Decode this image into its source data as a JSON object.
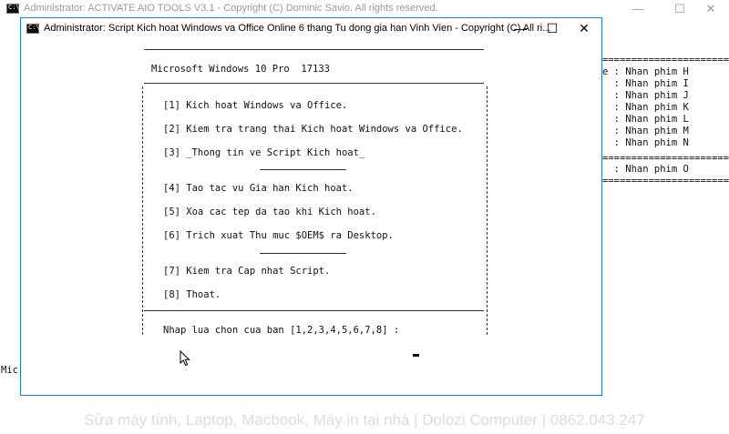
{
  "back_window": {
    "title": "Administrator:  ACTIVATE AIO TOOLS V3.1 - Copyright (C) Dominic Savio. All rights reserved.",
    "right_panel_lines": [
      "========================",
      "e : Nhan phim H",
      "  : Nhan phim I",
      "  : Nhan phim J",
      "  : Nhan phim K",
      "  : Nhan phim L",
      "  : Nhan phim M",
      "  : Nhan phim N",
      "========================",
      "  : Nhan phim O",
      "========================"
    ],
    "left_dot": ".",
    "left_partial_text": "Mic"
  },
  "front_window": {
    "title": "Administrator:  Script Kich hoat Windows va Office Online 6 thang Tu dong gia han Vinh Vien - Copyright (C) All ri...",
    "os_info": "Microsoft Windows 10 Pro  17133",
    "menu": [
      {
        "label": "[1] Kich hoat Windows va Office."
      },
      {
        "label": "[2] Kiem tra trang thai Kich hoat Windows va Office."
      },
      {
        "label": "[3] _Thong tin ve Script Kich hoat_"
      },
      {
        "label": "[4] Tao tac vu Gia han Kich hoat."
      },
      {
        "label": "[5] Xoa cac tep da tao khi Kich hoat."
      },
      {
        "label": "[6] Trich xuat Thu muc $OEM$ ra Desktop."
      },
      {
        "label": "[7] Kiem tra Cap nhat Script."
      },
      {
        "label": "[8] Thoat."
      }
    ],
    "prompt": "Nhap lua chon cua ban [1,2,3,4,5,6,7,8] :"
  },
  "window_controls": {
    "minimize": "—",
    "maximize": "☐",
    "close": "✕"
  },
  "watermark": "Sửa máy tính, Laptop, Macbook, Máy in tại nhà | Dolozi Computer | 0862.043.247",
  "colors": {
    "console_text": "#111111",
    "window_border": "#1c7ed6",
    "inactive_title": "#9a9a9a"
  }
}
